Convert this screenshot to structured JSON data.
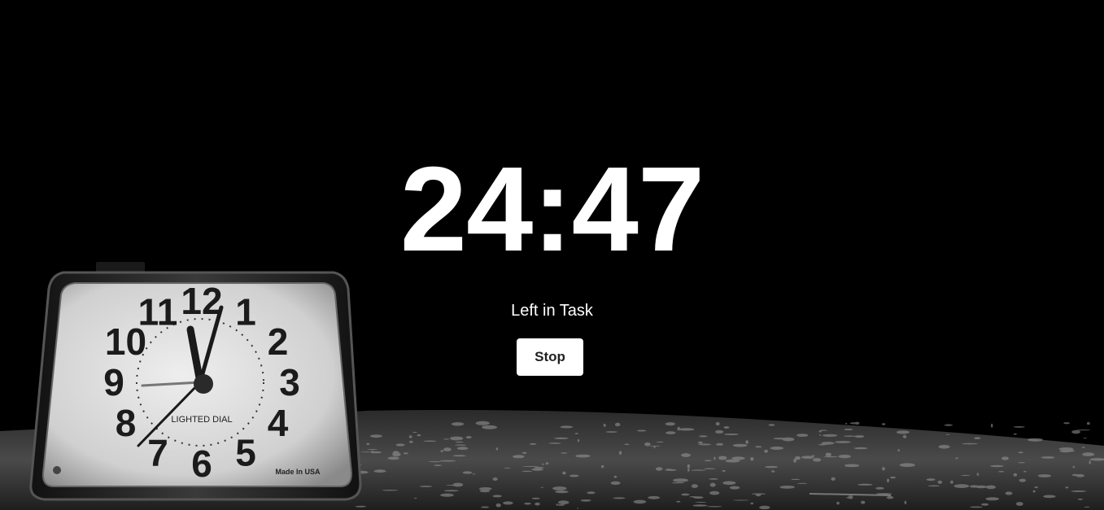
{
  "timer": {
    "remaining": "24:47",
    "label": "Left in Task"
  },
  "controls": {
    "stop_label": "Stop"
  },
  "clock_photo": {
    "dial_text": "LIGHTED DIAL",
    "maker_text": "Made In USA",
    "numerals": [
      "12",
      "1",
      "2",
      "3",
      "4",
      "5",
      "6",
      "7",
      "8",
      "9",
      "10",
      "11"
    ],
    "shown_time": "11:59"
  },
  "colors": {
    "background": "#000000",
    "text": "#ffffff",
    "button_bg": "#ffffff",
    "button_text": "#222222"
  }
}
